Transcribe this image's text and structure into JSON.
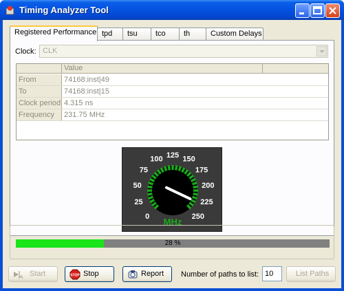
{
  "window": {
    "title": "Timing Analyzer Tool"
  },
  "tabs": [
    "Registered Performance",
    "tpd",
    "tsu",
    "tco",
    "th",
    "Custom Delays"
  ],
  "clock": {
    "label": "Clock:",
    "value": "CLK"
  },
  "grid": {
    "header": "Value",
    "rows": [
      {
        "label": "From",
        "value": "74168:inst|49"
      },
      {
        "label": "To",
        "value": "74168:inst|15"
      },
      {
        "label": "Clock period",
        "value": "4.315 ns"
      },
      {
        "label": "Frequency",
        "value": "231.75 MHz"
      }
    ]
  },
  "gauge": {
    "ticks": [
      "0",
      "25",
      "50",
      "75",
      "100",
      "125",
      "150",
      "175",
      "200",
      "225",
      "250"
    ],
    "unit": "MHz",
    "value": 231.75,
    "max": 250,
    "colors": {
      "dial": "#000000",
      "ticks": "#1aa81a",
      "needle": "#ffffff",
      "unit": "#1aa81a"
    }
  },
  "progress": {
    "percent": 28,
    "text": "28 %",
    "color": "#1ae41a"
  },
  "buttons": {
    "start": "Start",
    "stop": "Stop",
    "report": "Report",
    "list_paths": "List Paths"
  },
  "paths": {
    "label": "Number of paths to list:",
    "value": "10"
  }
}
